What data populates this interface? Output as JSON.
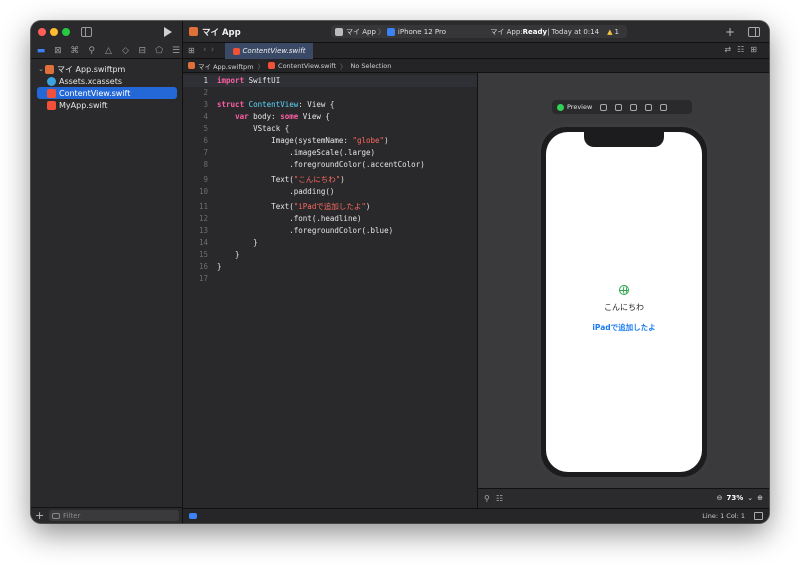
{
  "window": {
    "app_title": "マイ App",
    "traffic_colors": [
      "#ff5f57",
      "#febc2e",
      "#28c840"
    ]
  },
  "scheme": {
    "target": "マイ App",
    "device": "iPhone 12 Pro",
    "status_app": "マイ App: ",
    "status_state": "Ready",
    "status_time": " | Today at 0:14",
    "warnings": "1"
  },
  "tab": {
    "label": "ContentView.swift"
  },
  "jumpbar": {
    "crumbs": [
      "マイ App.swiftpm",
      "ContentView.swift",
      "No Selection"
    ]
  },
  "navigator": {
    "items": [
      {
        "label": "マイ App.swiftpm",
        "icon": "package-icon"
      },
      {
        "label": "Assets.xcassets",
        "icon": "assets-icon"
      },
      {
        "label": "ContentView.swift",
        "icon": "swift-file-icon",
        "selected": true
      },
      {
        "label": "MyApp.swift",
        "icon": "swift-file-icon"
      }
    ],
    "filter_placeholder": "Filter"
  },
  "code": {
    "lines": [
      {
        "n": "1"
      },
      {
        "n": "2"
      },
      {
        "n": "3"
      },
      {
        "n": "4"
      },
      {
        "n": "5"
      },
      {
        "n": "6"
      },
      {
        "n": "7"
      },
      {
        "n": "8"
      },
      {
        "n": "9"
      },
      {
        "n": "10"
      },
      {
        "n": "11"
      },
      {
        "n": "12"
      },
      {
        "n": "13"
      },
      {
        "n": "14"
      },
      {
        "n": "15"
      },
      {
        "n": "16"
      },
      {
        "n": "17"
      }
    ],
    "t": {
      "l1a": "import",
      "l1b": " SwiftUI",
      "l3a": "struct",
      "l3b": " ",
      "l3c": "ContentView",
      "l3d": ": View {",
      "l4a": "    ",
      "l4b": "var",
      "l4c": " body: ",
      "l4d": "some",
      "l4e": " View {",
      "l5": "        VStack {",
      "l6a": "            Image(systemName: ",
      "l6b": "\"globe\"",
      "l6c": ")",
      "l7": "                .imageScale(.large)",
      "l8": "                .foregroundColor(.accentColor)",
      "l9a": "            Text(",
      "l9b": "\"こんにちわ\"",
      "l9c": ")",
      "l10": "                .padding()",
      "l11a": "            Text(",
      "l11b": "\"iPadで追加したよ\"",
      "l11c": ")",
      "l12": "                .font(.headline)",
      "l13": "                .foregroundColor(.blue)",
      "l14": "        }",
      "l15": "    }",
      "l16": "}"
    }
  },
  "preview": {
    "label": "Preview",
    "hello_text": "こんにちわ",
    "ipad_text": "iPadで追加したよ",
    "zoom": "73%"
  },
  "statusbar": {
    "line_col": "Line: 1  Col: 1"
  }
}
